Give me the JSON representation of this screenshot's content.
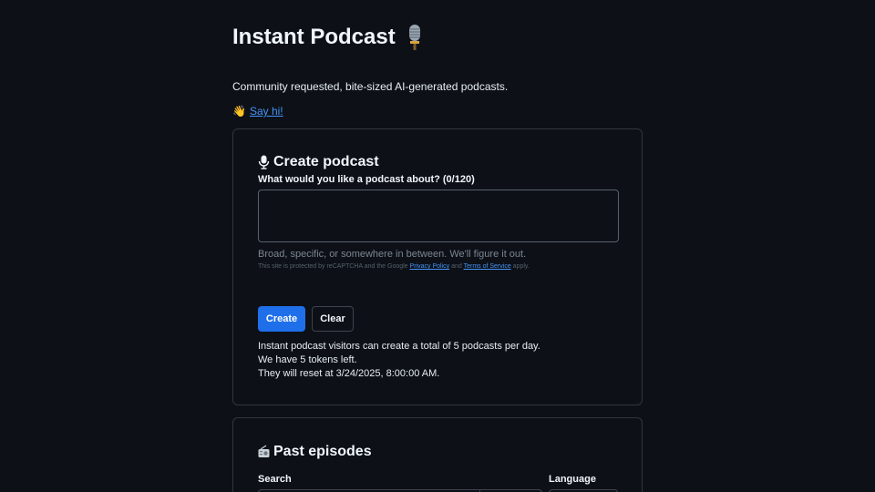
{
  "header": {
    "title": "Instant Podcast",
    "title_icon": "studio-microphone-emoji"
  },
  "tagline": "Community requested, bite-sized AI-generated podcasts.",
  "say_hi": {
    "emoji": "👋",
    "label": "Say hi!"
  },
  "create": {
    "heading": "Create podcast",
    "heading_icon": "microphone-icon",
    "field_label": "What would you like a podcast about? (0/120)",
    "textarea_value": "",
    "hint": "Broad, specific, or somewhere in between. We'll figure it out.",
    "recaptcha": {
      "prefix": "This site is protected by reCAPTCHA and the Google",
      "privacy": "Privacy Policy",
      "and": "and",
      "terms": "Terms of Service",
      "suffix": "apply."
    },
    "create_button": "Create",
    "clear_button": "Clear",
    "info_lines": [
      "Instant podcast visitors can create a total of 5 podcasts per day.",
      "We have 5 tokens left.",
      "They will reset at 3/24/2025, 8:00:00 AM."
    ]
  },
  "past": {
    "heading": "Past episodes",
    "heading_icon": "radio-icon",
    "search_label": "Search",
    "language_label": "Language"
  },
  "colors": {
    "background": "#0d1117",
    "primary_button": "#1f6feb",
    "link": "#4493f8",
    "border": "#30363d"
  }
}
